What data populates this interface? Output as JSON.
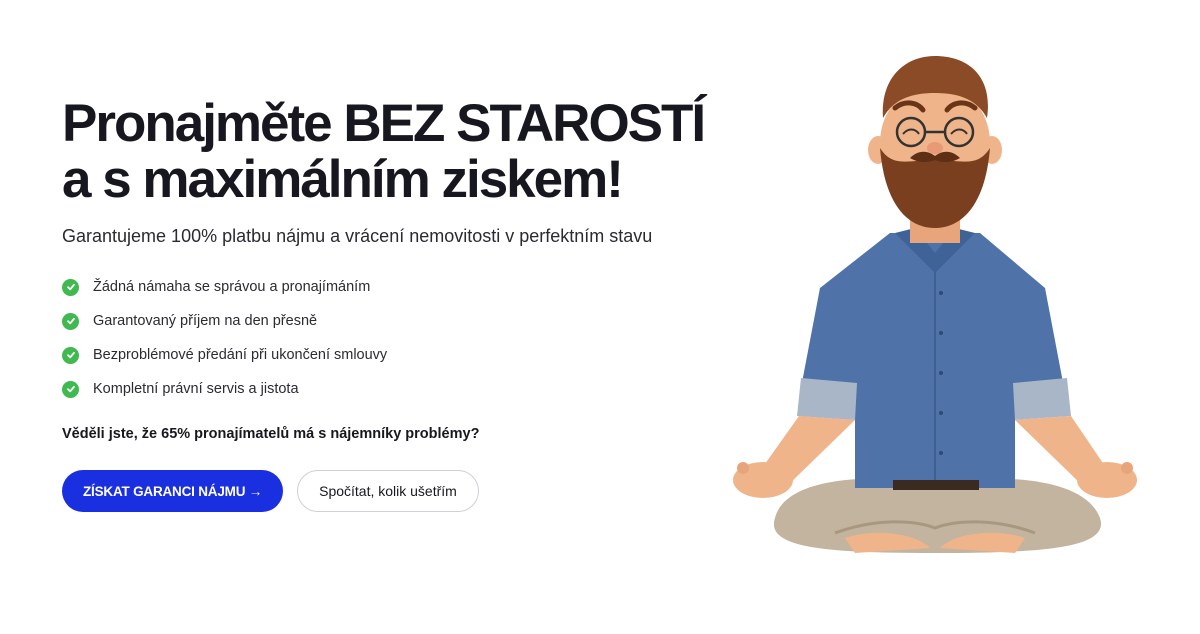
{
  "hero": {
    "headline_line1": "Pronajměte BEZ STAROSTÍ",
    "headline_line2": "a s maximálním ziskem!",
    "subtitle": "Garantujeme 100% platbu nájmu a vrácení nemovitosti v perfektním stavu",
    "features": [
      {
        "icon": "check-circle-icon",
        "label": "Žádná námaha se správou a pronajímáním"
      },
      {
        "icon": "check-circle-icon",
        "label": "Garantovaný příjem na den přesně"
      },
      {
        "icon": "check-circle-icon",
        "label": "Bezproblémové předání při ukončení smlouvy"
      },
      {
        "icon": "check-circle-icon",
        "label": "Kompletní právní servis a jistota"
      }
    ],
    "question": "Věděli jste, že 65% pronajímatelů má s nájemníky problémy?",
    "primary_button": "ZÍSKAT GARANCI NÁJMU →",
    "secondary_button": "Spočítat, kolik ušetřím"
  },
  "colors": {
    "primary": "#1a2fe0",
    "check": "#3fb950",
    "text": "#17171f",
    "shirt": "#4f73a8",
    "pants": "#c3b49f",
    "beard": "#7a3f1e",
    "skin": "#f0b48b"
  },
  "illustration": {
    "name": "meditating-man-illustration"
  }
}
